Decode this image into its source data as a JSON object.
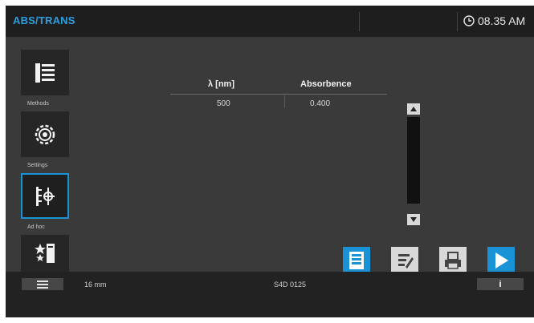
{
  "header": {
    "title": "ABS/TRANS",
    "time": "08.35 AM"
  },
  "sidebar": {
    "items": [
      {
        "label": "Methods",
        "icon": "methods-list-icon"
      },
      {
        "label": "Settings",
        "icon": "settings-gear-icon"
      },
      {
        "label": "Ad hoc",
        "icon": "adhoc-wavelength-icon",
        "active": true
      },
      {
        "label": "",
        "icon": "favorites-stars-icon"
      }
    ]
  },
  "table": {
    "columns": [
      "λ [nm]",
      "Absorbence"
    ],
    "rows": [
      {
        "wavelength": "500",
        "absorbance": "0.400"
      }
    ]
  },
  "actions": [
    {
      "name": "store-button",
      "icon": "store-icon",
      "accent": "#1a92d6"
    },
    {
      "name": "edit-button",
      "icon": "edit-icon",
      "accent": "#d9d9d9"
    },
    {
      "name": "print-button",
      "icon": "print-icon",
      "accent": "#d9d9d9"
    },
    {
      "name": "start-button",
      "icon": "play-icon",
      "accent": "#1a92d6"
    }
  ],
  "status": {
    "path_length": "16 mm",
    "device_id": "S4D 0125"
  },
  "colors": {
    "accent": "#1a92d6",
    "title": "#2d9fe0"
  }
}
